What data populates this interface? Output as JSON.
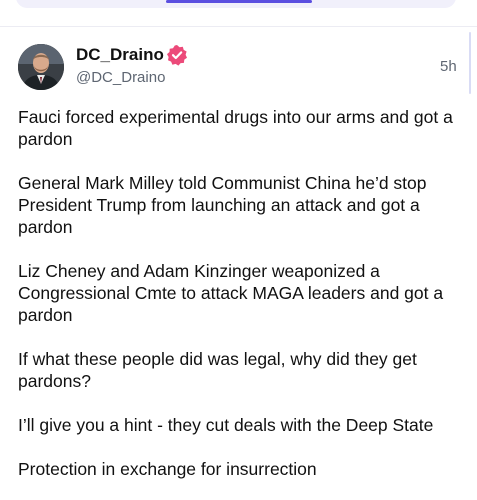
{
  "post": {
    "display_name": "DC_Draino",
    "handle": "@DC_Draino",
    "timestamp": "5h",
    "paragraphs": [
      "Fauci forced experimental drugs into our arms and got a pardon",
      "General Mark Milley told Communist China he’d stop President Trump from launching an attack and got a pardon",
      "Liz Cheney and Adam Kinzinger weaponized a Congressional Cmte to attack MAGA leaders and got a pardon",
      "If what these people did was legal, why did they get pardons?",
      "I’ll give you a hint - they cut deals with the Deep State",
      "Protection in exchange for insurrection"
    ]
  },
  "icons": {
    "verified_badge": "verified-badge-icon",
    "avatar": "profile-photo"
  },
  "colors": {
    "accent": "#5b4fe0",
    "verified": "#ec4a7a",
    "text": "#111111",
    "muted": "#5e6672"
  }
}
